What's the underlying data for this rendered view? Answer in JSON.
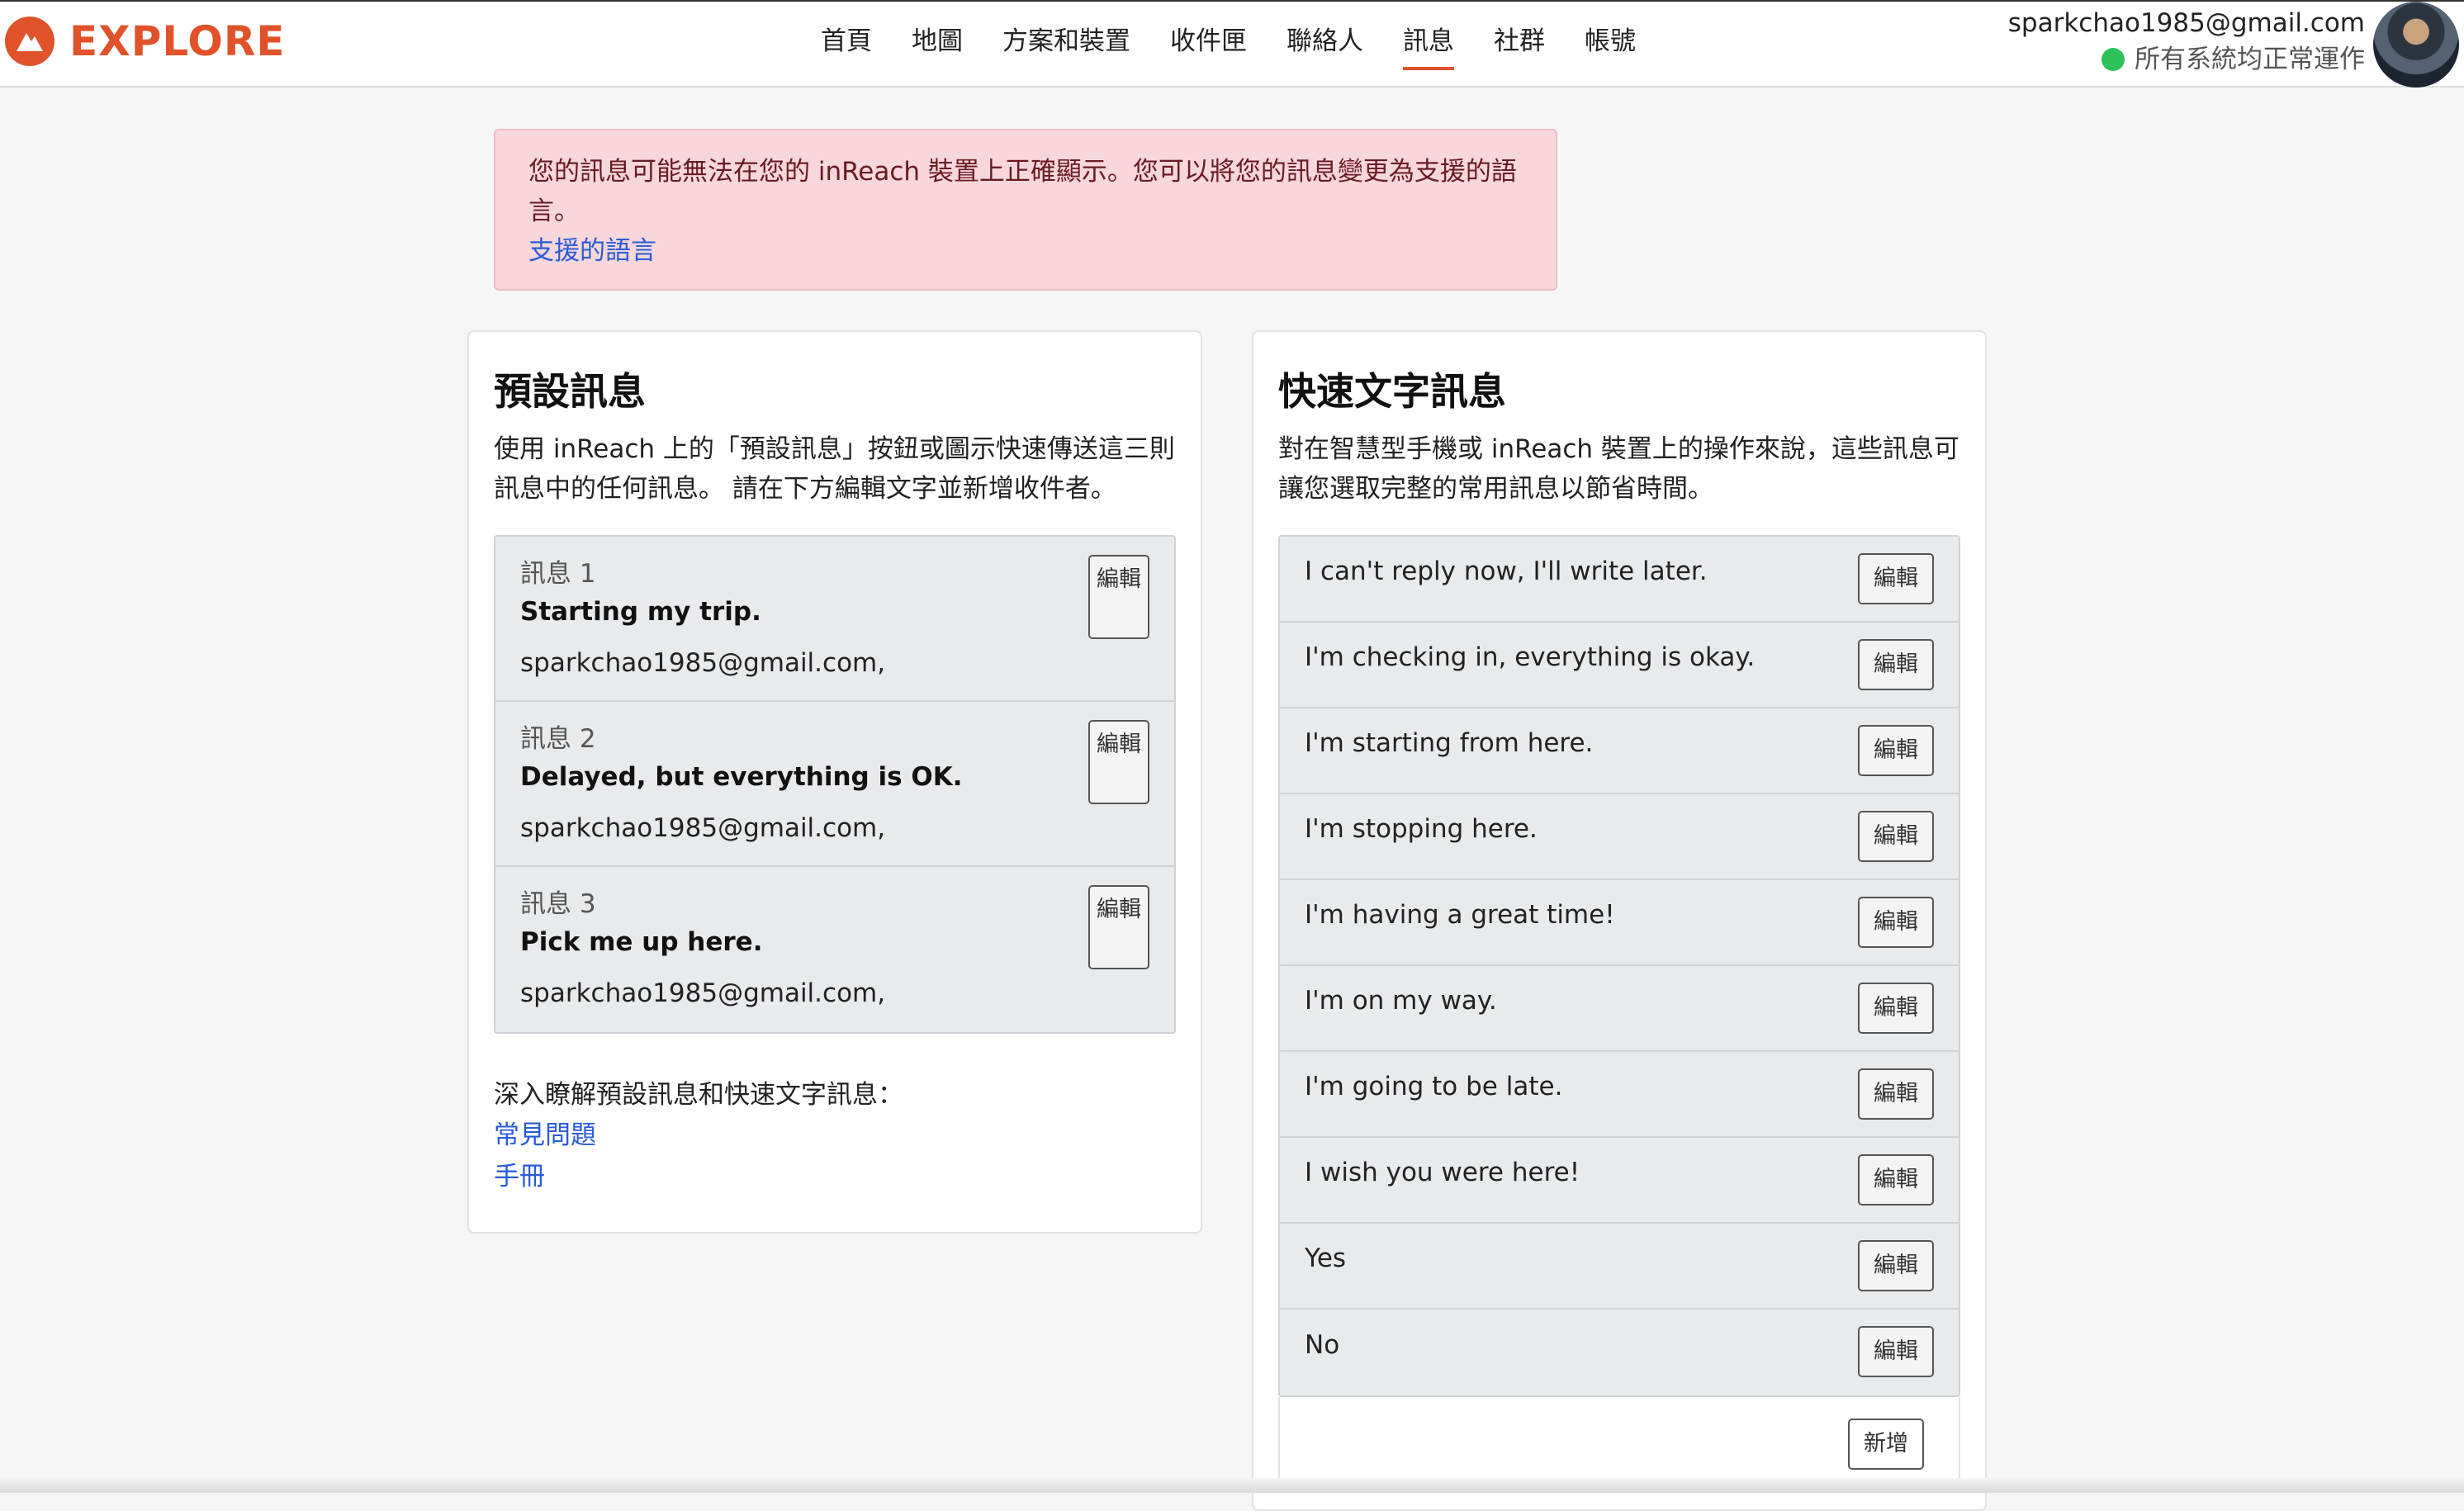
{
  "header": {
    "logo_text": "EXPLORE",
    "nav": [
      "首頁",
      "地圖",
      "方案和裝置",
      "收件匣",
      "聯絡人",
      "訊息",
      "社群",
      "帳號"
    ],
    "active_nav": "訊息",
    "account_email": "sparkchao1985@gmail.com",
    "system_status": "所有系統均正常運作"
  },
  "alert": {
    "text": "您的訊息可能無法在您的 inReach 裝置上正確顯示。您可以將您的訊息變更為支援的語言。",
    "link": "支援的語言"
  },
  "preset": {
    "title": "預設訊息",
    "description": "使用 inReach 上的「預設訊息」按鈕或圖示快速傳送這三則訊息中的任何訊息。 請在下方編輯文字並新增收件者。",
    "edit_label": "編輯",
    "items": [
      {
        "label": "訊息 1",
        "message": "Starting my trip.",
        "recipients": "sparkchao1985@gmail.com,"
      },
      {
        "label": "訊息 2",
        "message": "Delayed, but everything is OK.",
        "recipients": "sparkchao1985@gmail.com,"
      },
      {
        "label": "訊息 3",
        "message": "Pick me up here.",
        "recipients": "sparkchao1985@gmail.com,"
      }
    ],
    "more_info": "深入瞭解預設訊息和快速文字訊息：",
    "links": [
      "常見問題",
      "手冊"
    ]
  },
  "quick": {
    "title": "快速文字訊息",
    "description": "對在智慧型手機或 inReach 裝置上的操作來說，這些訊息可讓您選取完整的常用訊息以節省時間。",
    "edit_label": "編輯",
    "add_label": "新增",
    "items": [
      "I can't reply now, I'll write later.",
      "I'm checking in, everything is okay.",
      "I'm starting from here.",
      "I'm stopping here.",
      "I'm having a great time!",
      "I'm on my way.",
      "I'm going to be late.",
      "I wish you were here!",
      "Yes",
      "No"
    ]
  },
  "colors": {
    "brand": "#e0532a",
    "alert_bg": "#f8d7dc",
    "link": "#2a5bd7",
    "status_ok": "#2fc15a"
  }
}
